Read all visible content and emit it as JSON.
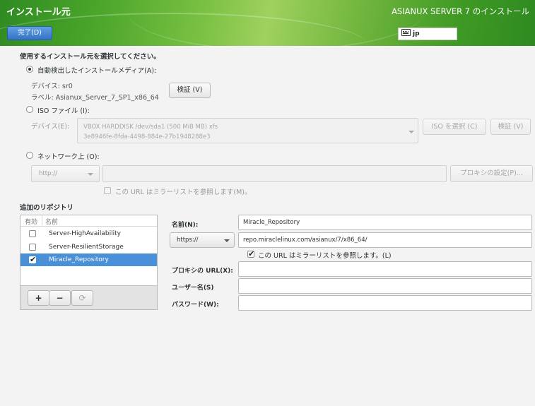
{
  "header": {
    "title": "インストール元",
    "product": "ASIANUX SERVER 7 のインストール",
    "done_button": "完了(D)",
    "keyboard_layout": "jp"
  },
  "source": {
    "heading": "使用するインストール元を選択してください。",
    "auto_media": {
      "label": "自動検出したインストールメディア(A):",
      "selected": true,
      "device_line": "デバイス: sr0",
      "label_line": "ラベル: Asianux_Server_7_SP1_x86_64",
      "verify_button": "検証 (V)"
    },
    "iso": {
      "label": "ISO ファイル (I):",
      "device_label": "デバイス(E):",
      "device_line1": "VBOX HARDDISK /dev/sda1 (500 MiB MB) xfs",
      "device_line2": "3e8946fe-8fda-4498-884e-27b1948288e3",
      "choose_iso_button": "ISO を選択 (C)",
      "verify_button": "検証 (V)"
    },
    "network": {
      "label": "ネットワーク上 (O):",
      "protocol": "http://",
      "url": "",
      "proxy_button": "プロキシの設定(P)...",
      "mirrorlist_label": "この URL はミラーリストを参照します(M)。"
    }
  },
  "repos": {
    "heading": "追加のリポジトリ",
    "col_enabled": "有効",
    "col_name": "名前",
    "items": [
      {
        "name": "Server-HighAvailability",
        "enabled": false,
        "selected": false
      },
      {
        "name": "Server-ResilientStorage",
        "enabled": false,
        "selected": false
      },
      {
        "name": "Miracle_Repository",
        "enabled": true,
        "selected": true
      }
    ],
    "add_glyph": "+",
    "remove_glyph": "−",
    "reset_glyph": "⟳"
  },
  "repo_form": {
    "name_label": "名前(N):",
    "name_value": "Miracle_Repository",
    "protocol": "https://",
    "url_value": "repo.miraclelinux.com/asianux/7/x86_64/",
    "mirrorlist_label": "この URL はミラーリストを参照します。(L)",
    "mirrorlist_checked": true,
    "proxy_label": "プロキシの URL(X):",
    "proxy_value": "",
    "user_label": "ユーザー名(S)",
    "user_value": "",
    "password_label": "パスワード(W):",
    "password_value": ""
  },
  "icons": {
    "keyboard": "keyboard-icon",
    "dropdown": "chevron-down-icon",
    "checkmark": "checkmark-icon",
    "reset": "refresh-icon"
  },
  "colors": {
    "header_green": "#4aa52a",
    "accent_blue": "#4a90d9",
    "background": "#f3f3f3"
  }
}
